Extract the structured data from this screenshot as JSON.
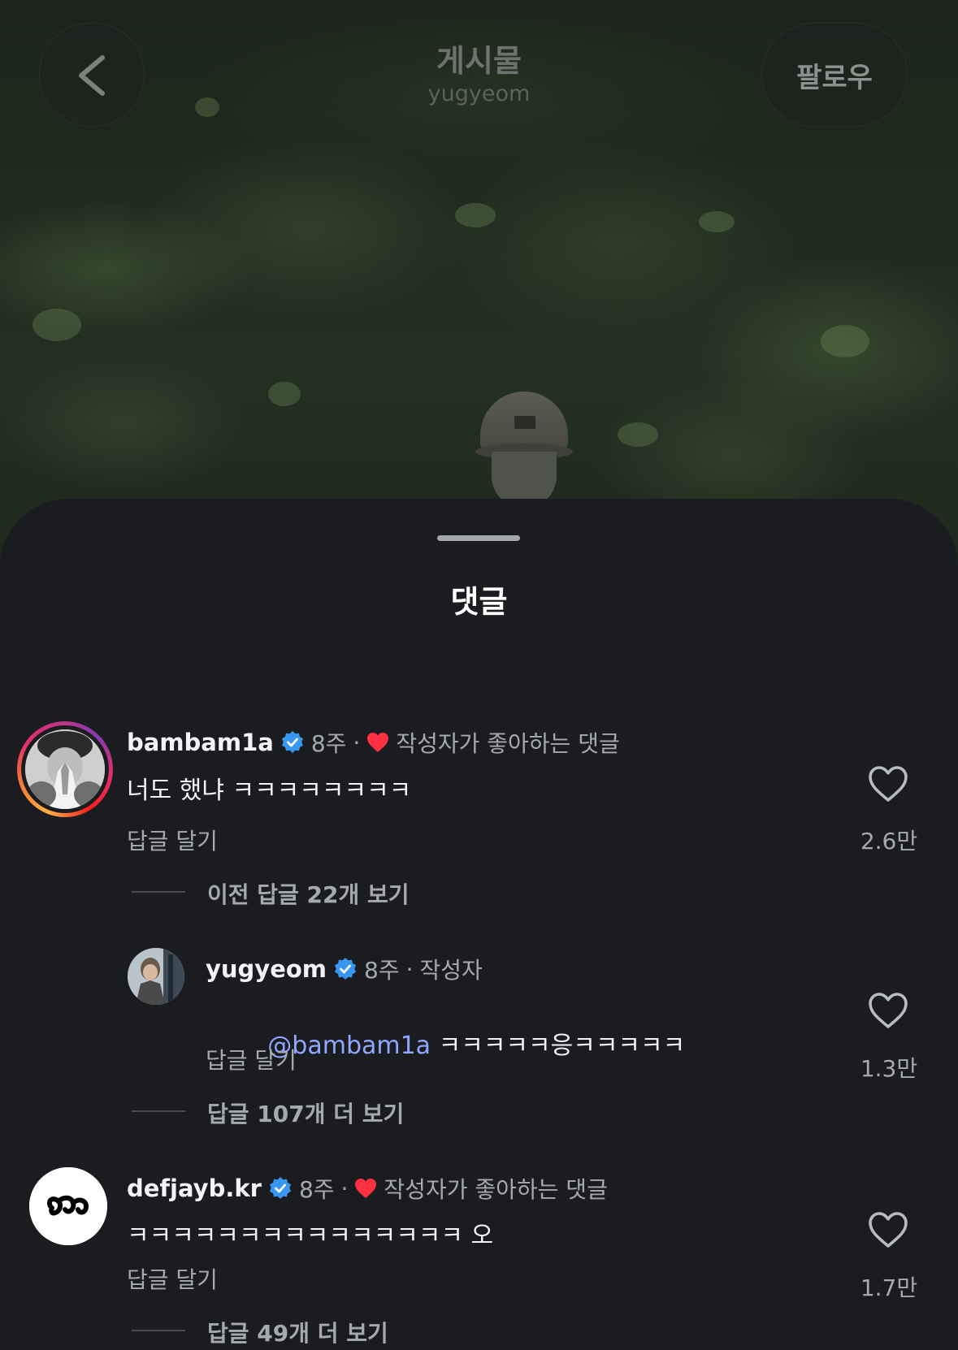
{
  "header": {
    "title": "게시물",
    "subtitle": "yugyeom",
    "follow_label": "팔로우",
    "back_icon": "chevron-left-icon"
  },
  "sheet": {
    "title": "댓글"
  },
  "comments": [
    {
      "username": "bambam1a",
      "verified": true,
      "time": "8주",
      "separator": "·",
      "badge": "작성자가 좋아하는 댓글",
      "text": "너도 했냐 ㅋㅋㅋㅋㅋㅋㅋㅋ",
      "reply_label": "답글 달기",
      "likes": "2.6만",
      "thread_label": "이전 답글 22개 보기",
      "has_story_ring": true
    },
    {
      "username": "yugyeom",
      "verified": true,
      "time": "8주",
      "separator": "·",
      "badge": "작성자",
      "mention": "@bambam1a",
      "text": " ㅋㅋㅋㅋㅋ응ㅋㅋㅋㅋㅋ",
      "reply_label": "답글 달기",
      "likes": "1.3만",
      "thread_label": "답글 107개 더 보기",
      "is_reply": true
    },
    {
      "username": "defjayb.kr",
      "verified": true,
      "time": "8주",
      "separator": "·",
      "badge": "작성자가 좋아하는 댓글",
      "text": "ㅋㅋㅋㅋㅋㅋㅋㅋㅋㅋㅋㅋㅋㅋㅋ 오",
      "reply_label": "답글 달기",
      "likes": "1.7만",
      "thread_label": "답글 49개 더 보기"
    }
  ],
  "colors": {
    "sheet_bg": "#1b1c20",
    "verified_blue": "#3897f0",
    "heart_red": "#ff3040",
    "mention_blue": "#8fa7ff"
  }
}
